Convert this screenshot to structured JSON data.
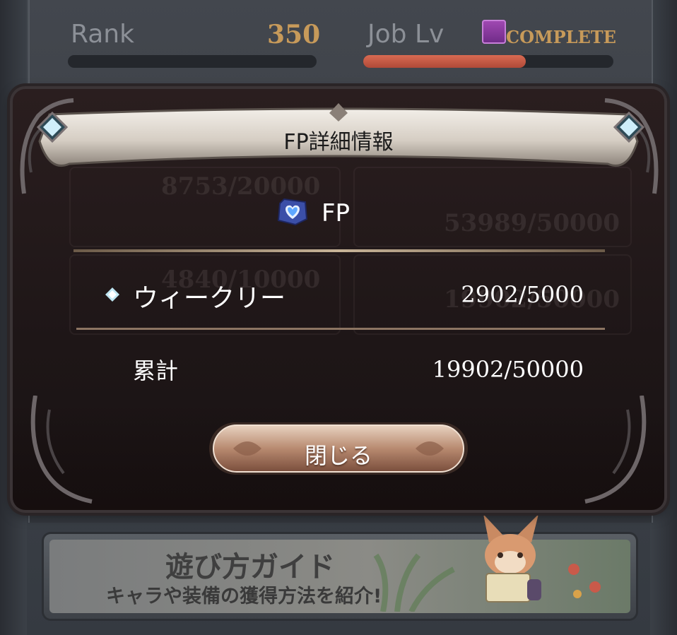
{
  "status": {
    "rank_label": "Rank",
    "rank_value": "350",
    "job_label": "Job Lv",
    "job_status": "COMPLETE",
    "rank_progress": 0.0,
    "job_progress": 0.65
  },
  "dialog": {
    "title": "FP詳細情報",
    "section_label": "FP",
    "weekly_label": "ウィークリー",
    "weekly_value": "2902/5000",
    "total_label": "累計",
    "total_value": "19902/50000",
    "close_label": "閉じる"
  },
  "background_values": {
    "left_top": "8753/20000",
    "left_bottom": "4840/10000",
    "right_top": "53989/50000",
    "right_bottom": "19902/50000"
  },
  "guide_banner": {
    "title": "遊び方ガイド",
    "subtitle": "キャラや装備の獲得方法を紹介!"
  },
  "colors": {
    "accent_gold": "#c79a5a",
    "job_bar": "#c4533f",
    "dialog_bg": "#1e1617",
    "banner": "#d8d2ca"
  }
}
